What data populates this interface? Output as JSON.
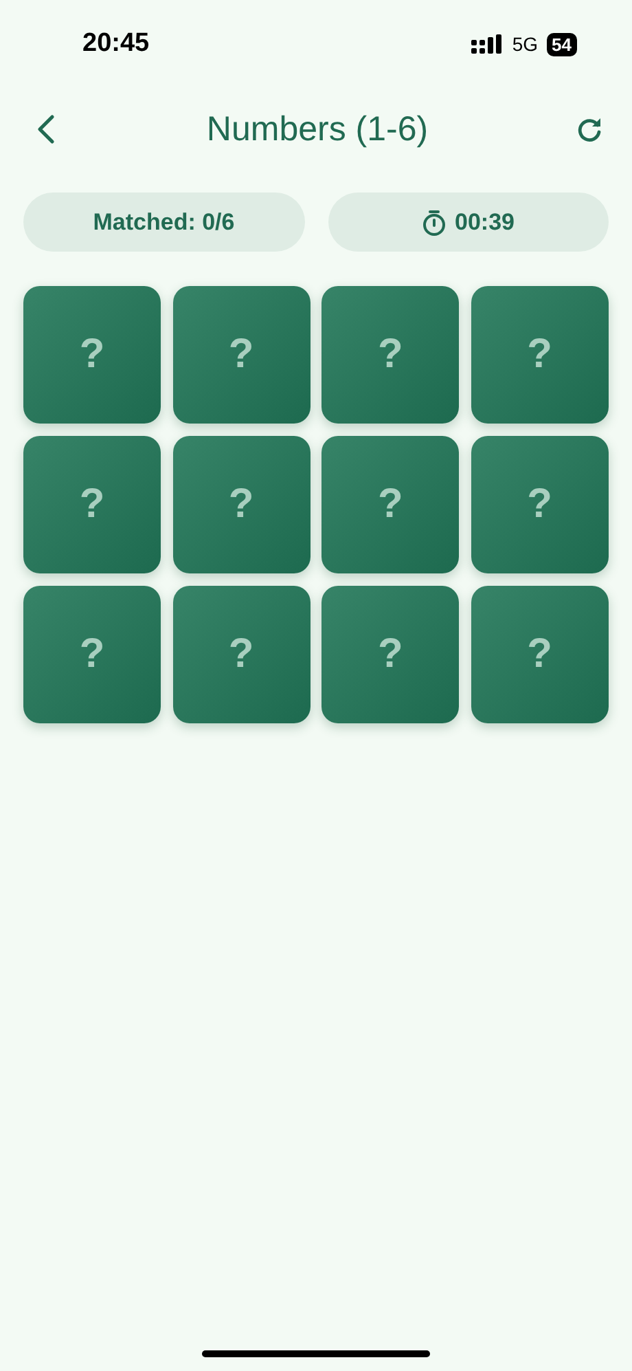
{
  "status_bar": {
    "time": "20:45",
    "network": "5G",
    "battery": "54"
  },
  "header": {
    "title": "Numbers (1-6)"
  },
  "stats": {
    "matched": "Matched: 0/6",
    "timer": "00:39"
  },
  "cards": [
    {
      "label": "?"
    },
    {
      "label": "?"
    },
    {
      "label": "?"
    },
    {
      "label": "?"
    },
    {
      "label": "?"
    },
    {
      "label": "?"
    },
    {
      "label": "?"
    },
    {
      "label": "?"
    },
    {
      "label": "?"
    },
    {
      "label": "?"
    },
    {
      "label": "?"
    },
    {
      "label": "?"
    }
  ]
}
